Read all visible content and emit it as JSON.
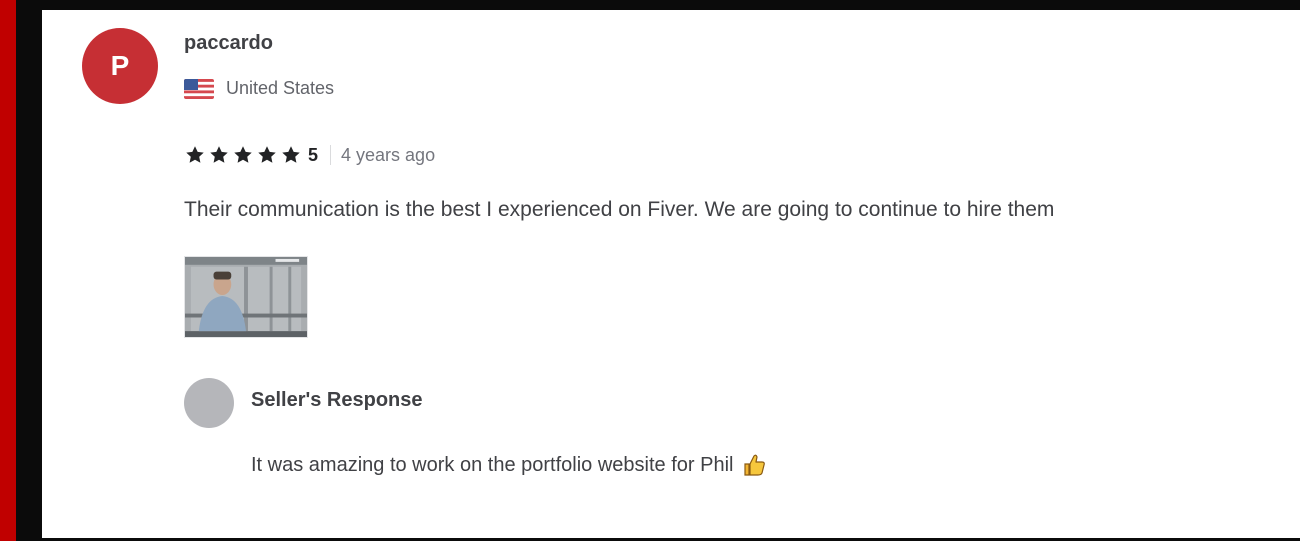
{
  "review": {
    "avatar_initial": "P",
    "avatar_color": "#c62f34",
    "username": "paccardo",
    "country": "United States",
    "country_flag_icon": "us-flag-icon",
    "rating": {
      "stars": 5,
      "value": "5"
    },
    "time_ago": "4 years ago",
    "text": "Their communication is the best I experienced on Fiver. We are going to continue to hire them",
    "attachment_icon": "video-thumbnail"
  },
  "seller_response": {
    "title": "Seller's Response",
    "text": "It was amazing to work on the portfolio website for Phil",
    "emoji_icon": "thumbs-up-icon"
  },
  "colors": {
    "outer_border": "#c00000",
    "star": "#222325",
    "seller_avatar": "#b5b6ba"
  }
}
